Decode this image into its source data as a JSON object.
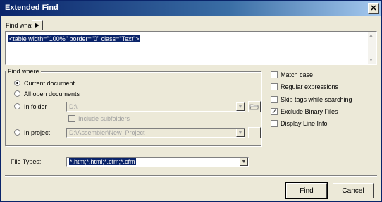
{
  "window": {
    "title": "Extended Find"
  },
  "find": {
    "label": "Find what:",
    "value": "<table width=\"100%\" border=\"0\" class=\"Text\">"
  },
  "find_where": {
    "title": "Find where",
    "current_document": "Current document",
    "all_open": "All open documents",
    "in_folder": "In folder",
    "folder_value": "D:\\",
    "include_subfolders": "Include subfolders",
    "in_project": "In project",
    "project_value": "D:\\Assembler\\New_Project"
  },
  "options": {
    "match_case": "Match case",
    "regex": "Regular expressions",
    "skip_tags": "Skip tags while searching",
    "exclude_binary": "Exclude Binary Files",
    "display_line_info": "Display Line Info"
  },
  "file_types": {
    "label": "File Types:",
    "value": "*.htm;*.html;*.cfm;*.cfm"
  },
  "buttons": {
    "find": "Find",
    "cancel": "Cancel"
  }
}
